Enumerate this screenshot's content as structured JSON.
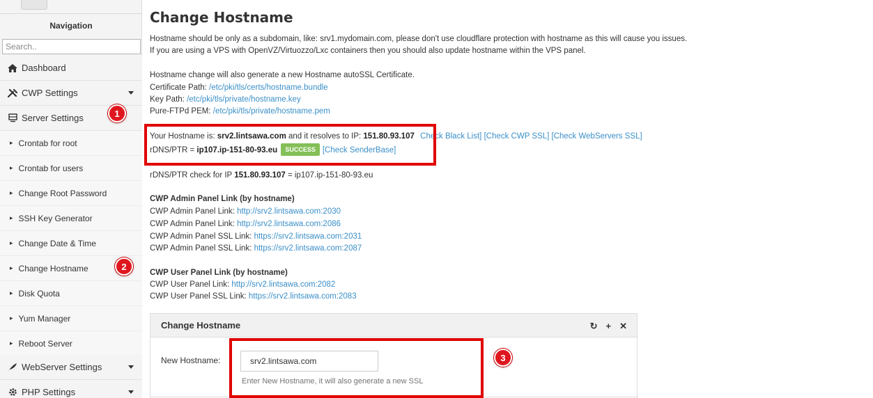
{
  "sidebar": {
    "nav_title": "Navigation",
    "search_placeholder": "Search..",
    "items": {
      "dashboard": "Dashboard",
      "cwp_settings": "CWP Settings",
      "server_settings": "Server Settings",
      "webserver_settings": "WebServer Settings",
      "php_settings": "PHP Settings"
    },
    "sub_items": [
      "Crontab for root",
      "Crontab for users",
      "Change Root Password",
      "SSH Key Generator",
      "Change Date & Time",
      "Change Hostname",
      "Disk Quota",
      "Yum Manager",
      "Reboot Server"
    ]
  },
  "badges": [
    "1",
    "2",
    "3"
  ],
  "main": {
    "title": "Change Hostname",
    "info1": "Hostname should be only as a subdomain, like: srv1.mydomain.com, please don't use cloudflare protection with hostname as this will cause you issues.",
    "info2": "If you are using a VPS with OpenVZ/Virtuozzo/Lxc containers then you should also update hostname within the VPS panel.",
    "autossl": "Hostname change will also generate a new Hostname autoSSL Certificate.",
    "cert_label": "Certificate Path: ",
    "cert_path": "/etc/pki/tls/certs/hostname.bundle",
    "key_label": "Key Path: ",
    "key_path": "/etc/pki/tls/private/hostname.key",
    "pem_label": "Pure-FTPd PEM: ",
    "pem_path": "/etc/pki/tls/private/hostname.pem",
    "hostname_prefix": "Your Hostname is: ",
    "hostname": "srv2.lintsawa.com",
    "resolves_text": " and it resolves to IP: ",
    "ip": "151.80.93.107",
    "check_blacklist": "Check Black List]",
    "check_cwp_ssl": "[Check CWP SSL]",
    "check_webservers_ssl": "[Check WebServers SSL]",
    "rdns_prefix": "rDNS/PTR = ",
    "rdns": "ip107.ip-151-80-93.eu",
    "success": "SUCCESS",
    "check_senderbase": "[Check SenderBase]",
    "rdns_check_prefix": "rDNS/PTR check for IP ",
    "rdns_check_ip": "151.80.93.107",
    "rdns_check_suffix": " = ip107.ip-151-80-93.eu",
    "admin_heading": "CWP Admin Panel Link (by hostname)",
    "admin_links": [
      {
        "label": "CWP Admin Panel Link: ",
        "url": "http://srv2.lintsawa.com:2030"
      },
      {
        "label": "CWP Admin Panel Link: ",
        "url": "http://srv2.lintsawa.com:2086"
      },
      {
        "label": "CWP Admin Panel SSL Link: ",
        "url": "https://srv2.lintsawa.com:2031"
      },
      {
        "label": "CWP Admin Panel SSL Link: ",
        "url": "https://srv2.lintsawa.com:2087"
      }
    ],
    "user_heading": "CWP User Panel Link (by hostname)",
    "user_links": [
      {
        "label": "CWP User Panel Link: ",
        "url": "http://srv2.lintsawa.com:2082"
      },
      {
        "label": "CWP User Panel SSL Link: ",
        "url": "https://srv2.lintsawa.com:2083"
      }
    ]
  },
  "panel": {
    "title": "Change Hostname",
    "field_label": "New Hostname:",
    "field_value": "srv2.lintsawa.com",
    "help": "Enter New Hostname, it will also generate a new SSL",
    "tool_refresh": "↻",
    "tool_expand": "+",
    "tool_close": "✕"
  },
  "colors": {
    "link": "#3a8fc8",
    "highlight": "#e00000",
    "success": "#84bf57"
  }
}
